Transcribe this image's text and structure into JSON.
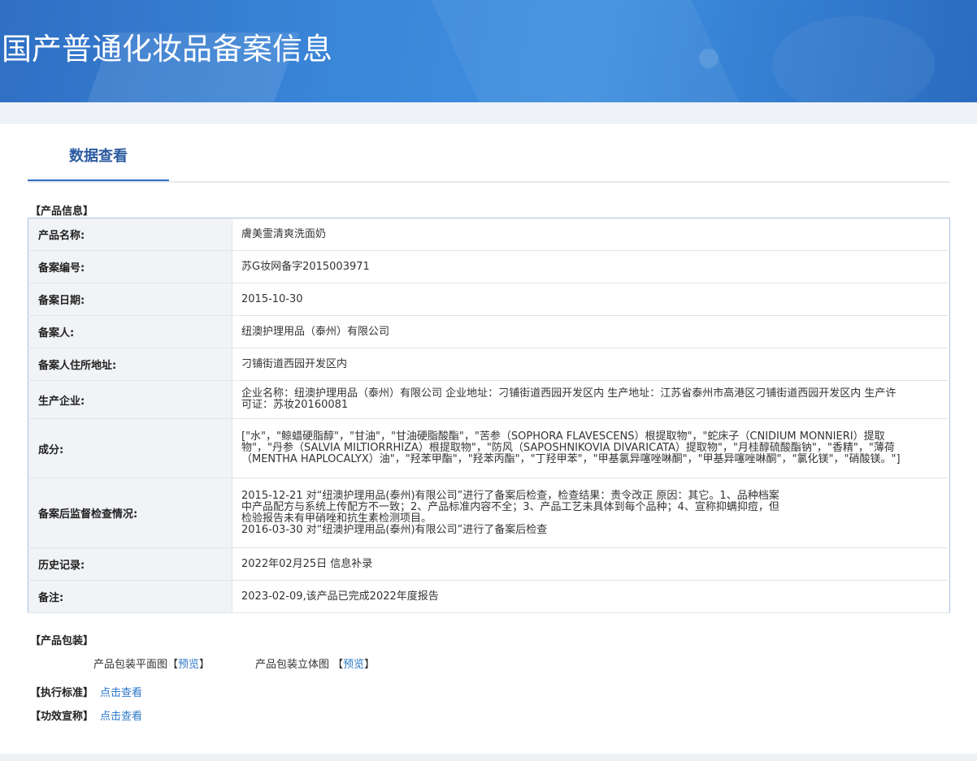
{
  "page_title": "国产普通化妆品备案信息",
  "tab_label": "数据查看",
  "product_info_title": "【产品信息】",
  "rows": [
    {
      "key": "产品名称:",
      "value": "膚美霊清爽洗面奶"
    },
    {
      "key": "备案编号:",
      "value": "苏G妆网备字2015003971"
    },
    {
      "key": "备案日期:",
      "value": "2015-10-30"
    },
    {
      "key": "备案人:",
      "value": "纽澳护理用品（泰州）有限公司"
    },
    {
      "key": "备案人住所地址:",
      "value": "刁铺街道西园开发区内"
    },
    {
      "key": "生产企业:",
      "value": "企业名称：纽澳护理用品（泰州）有限公司 企业地址：刁铺街道西园开发区内 生产地址：江苏省泰州市高港区刁铺街道西园开发区内 生产许可证：苏妆20160081"
    },
    {
      "key": "成分:",
      "value": "[\"水\"，\"鲸蜡硬脂醇\"，\"甘油\"，\"甘油硬脂酸酯\"，\"苦参（SOPHORA FLAVESCENS）根提取物\"，\"蛇床子（CNIDIUM MONNIERI）提取物\"，\"丹参（SALVIA MILTIORRHIZA）根提取物\"，\"防风（SAPOSHNIKOVIA DIVARICATA）提取物\"，\"月桂醇硫酸酯钠\"，\"香精\"，\"薄荷（MENTHA HAPLOCALYX）油\"，\"羟苯甲酯\"，\"羟苯丙酯\"，\"丁羟甲苯\"，\"甲基氯异噻唑啉酮\"，\"甲基异噻唑啉酮\"，\"氯化镁\"，\"硝酸镁。\"]"
    },
    {
      "key": "备案后监督检查情况:",
      "value_lines": [
        "2015-12-21 对“纽澳护理用品(泰州)有限公司”进行了备案后检查，检查结果：责令改正 原因：其它。1、品种档案",
        "中产品配方与系统上传配方不一致；2、产品标准内容不全；3、产品工艺未具体到每个品种；4、宣称抑螨抑痘，但",
        "检验报告未有甲硝唑和抗生素检测项目。",
        "2016-03-30 对“纽澳护理用品(泰州)有限公司”进行了备案后检查"
      ]
    },
    {
      "key": "历史记录:",
      "value": "2022年02月25日 信息补录"
    },
    {
      "key": "备注:",
      "value": "2023-02-09,该产品已完成2022年度报告"
    }
  ],
  "packaging": {
    "title": "【产品包装】",
    "flat_label": "产品包装平面图【",
    "flat_link": "预览",
    "flat_close": "】",
    "solid_label": "产品包装立体图 【",
    "solid_link": "预览",
    "solid_close": "】"
  },
  "standard": {
    "label": "【执行标准】",
    "link": "点击查看"
  },
  "claims": {
    "label": "【功效宣称】",
    "link": "点击查看"
  }
}
